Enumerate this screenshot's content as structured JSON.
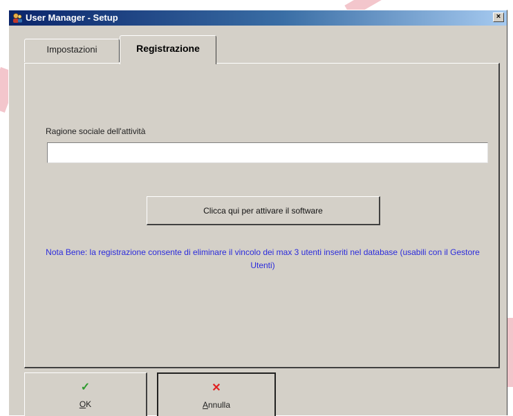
{
  "window": {
    "title": "User Manager - Setup",
    "close_label": "×"
  },
  "tabs": [
    {
      "label": "Impostazioni",
      "active": false
    },
    {
      "label": "Registrazione",
      "active": true
    }
  ],
  "registration": {
    "field_label": "Ragione sociale dell'attività",
    "field_value": "",
    "activate_button": "Clicca qui per attivare il software",
    "note": "Nota Bene: la registrazione consente di eliminare il vincolo dei max 3 utenti inseriti nel database (usabili con il Gestore Utenti)"
  },
  "buttons": {
    "ok": {
      "label": "OK",
      "icon": "check-icon",
      "icon_glyph": "✓"
    },
    "cancel": {
      "label": "Annulla",
      "icon": "cross-icon",
      "icon_glyph": "✕"
    }
  },
  "colors": {
    "dialog_bg": "#d4d0c8",
    "titlebar_start": "#0a246a",
    "titlebar_end": "#a6caf0",
    "note_text": "#2b2bdc",
    "ok_icon": "#2e9b2e",
    "cancel_icon": "#e02020"
  }
}
